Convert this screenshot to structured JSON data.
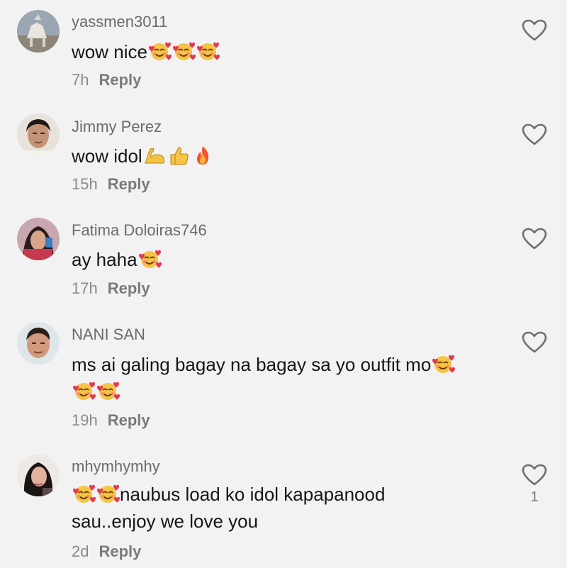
{
  "comments": [
    {
      "username": "yassmen3011",
      "text": "wow nice",
      "emojis": [
        "smiling-face-with-hearts-icon",
        "smiling-face-with-hearts-icon",
        "smiling-face-with-hearts-icon"
      ],
      "time": "7h",
      "reply_label": "Reply",
      "likes": ""
    },
    {
      "username": "Jimmy Perez",
      "text": "wow idol",
      "emojis": [
        "flexed-biceps-icon",
        "thumbs-up-icon",
        "fire-icon"
      ],
      "time": "15h",
      "reply_label": "Reply",
      "likes": ""
    },
    {
      "username": "Fatima Doloiras746",
      "text": "ay haha",
      "emojis": [
        "smiling-face-with-hearts-icon"
      ],
      "time": "17h",
      "reply_label": "Reply",
      "likes": ""
    },
    {
      "username": "NANI SAN",
      "text": "ms ai galing bagay na bagay sa yo outfit mo",
      "emojis": [
        "smiling-face-with-hearts-icon",
        "smiling-face-with-hearts-icon",
        "smiling-face-with-hearts-icon"
      ],
      "time": "19h",
      "reply_label": "Reply",
      "likes": ""
    },
    {
      "username": "mhymhymhy",
      "text_prefix_emojis": [
        "smiling-face-with-hearts-icon",
        "smiling-face-with-hearts-icon"
      ],
      "text": "naubus load ko idol kapapanood sau..enjoy we love you",
      "time": "2d",
      "reply_label": "Reply",
      "likes": "1"
    }
  ]
}
